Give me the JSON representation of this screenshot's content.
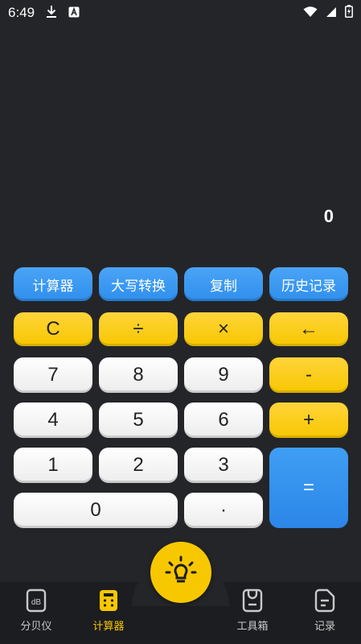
{
  "status": {
    "time": "6:49"
  },
  "display": {
    "value": "0"
  },
  "function_row": [
    "计算器",
    "大写转换",
    "复制",
    "历史记录"
  ],
  "keys": {
    "clear": "C",
    "divide": "÷",
    "multiply": "×",
    "backspace": "←",
    "seven": "7",
    "eight": "8",
    "nine": "9",
    "minus": "-",
    "four": "4",
    "five": "5",
    "six": "6",
    "plus": "+",
    "one": "1",
    "two": "2",
    "three": "3",
    "equals": "=",
    "zero": "0",
    "dot": "·"
  },
  "tabs": [
    {
      "label": "分贝仪",
      "icon": "decibel-icon"
    },
    {
      "label": "计算器",
      "icon": "calculator-icon"
    },
    {
      "label": "工具箱",
      "icon": "toolbox-icon"
    },
    {
      "label": "记录",
      "icon": "record-icon"
    }
  ],
  "fab": {
    "icon": "lightbulb-icon"
  },
  "colors": {
    "background": "#242528",
    "tab_bar": "#1c1d20",
    "accent_yellow": "#f7c700",
    "accent_blue": "#2f8fed",
    "key_white": "#ffffff"
  }
}
